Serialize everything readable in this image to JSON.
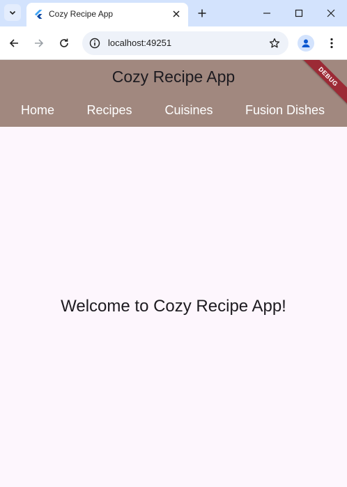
{
  "browser": {
    "tab_title": "Cozy Recipe App",
    "url": "localhost:49251"
  },
  "app": {
    "title": "Cozy Recipe App",
    "nav": [
      {
        "label": "Home"
      },
      {
        "label": "Recipes"
      },
      {
        "label": "Cuisines"
      },
      {
        "label": "Fusion Dishes"
      }
    ],
    "debug_label": "DEBUG",
    "welcome_text": "Welcome to Cozy Recipe App!",
    "colors": {
      "app_bar": "#a1887f",
      "background": "#fdf6fd",
      "debug_banner": "#9c2a35"
    }
  }
}
